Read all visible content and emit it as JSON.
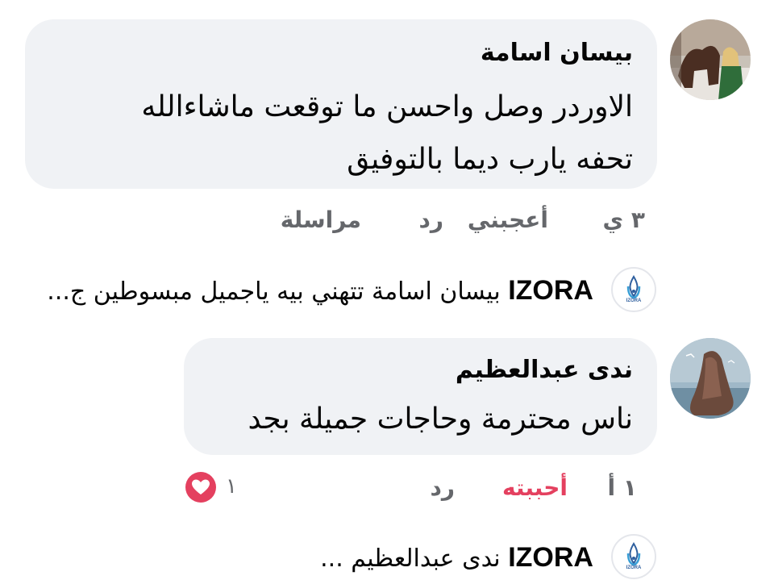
{
  "comments": [
    {
      "author": "بيسان اسامة",
      "lines": [
        "الاوردر وصل واحسن ما توقعت ماشاءالله",
        "تحفه يارب ديما بالتوفيق"
      ],
      "time": "٣ ي",
      "like_label": "أعجبني",
      "reply_label": "رد",
      "message_label": "مراسلة",
      "avatar_icon": "horse-carriage-photo"
    },
    {
      "author": "ندى عبدالعظيم",
      "lines": [
        "ناس محترمة وحاجات جميلة بجد"
      ],
      "time": "١ أ",
      "like_label": "أحببته",
      "reply_label": "رد",
      "reaction_count": "١",
      "reaction_icon": "heart-icon",
      "avatar_icon": "veiled-woman-photo"
    }
  ],
  "replies": [
    {
      "page": "IZORA",
      "preview": "بيسان اسامة تتهني بيه ياجميل مبسوطين ج...",
      "logo_text": "IZORA"
    },
    {
      "page": "IZORA",
      "preview": "ندى عبدالعظيم ...",
      "logo_text": "IZORA"
    }
  ],
  "colors": {
    "bubble": "#f0f2f5",
    "secondary_text": "#65676b",
    "love": "#e4405f",
    "logo": "#2f5f9e"
  }
}
